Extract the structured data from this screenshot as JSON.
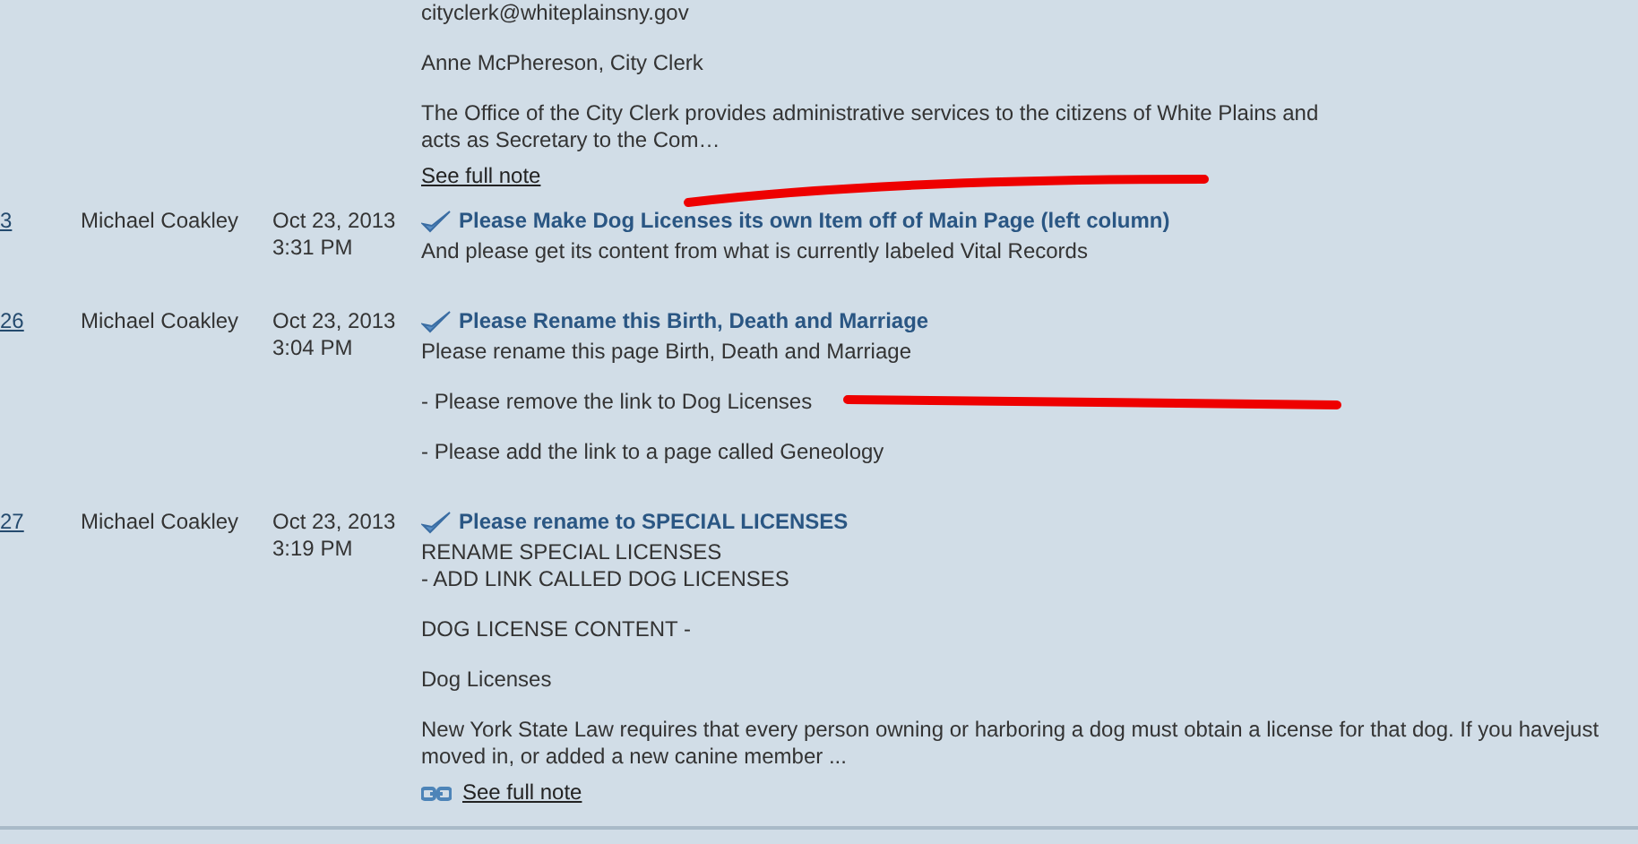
{
  "notes": [
    {
      "paragraphs": [
        {
          "lines": [
            "cityclerk@whiteplainsny.gov"
          ]
        },
        {
          "lines": [
            "Anne McPhereson, City Clerk"
          ]
        },
        {
          "lines": [
            "The Office of the City Clerk provides administrative services to the citizens of White Plains and",
            "acts as Secretary to the Com…"
          ]
        }
      ],
      "link": {
        "label": "See full note",
        "icon": false
      }
    },
    {
      "id": "3",
      "author": "Michael Coakley",
      "date": "Oct 23, 2013",
      "time": "3:31 PM",
      "title": "Please Make Dog Licenses its own Item off of Main Page (left column)",
      "paragraphs": [
        {
          "lines": [
            "And please get its content from what is currently labeled Vital Records"
          ]
        }
      ]
    },
    {
      "id": "26",
      "author": "Michael Coakley",
      "date": "Oct 23, 2013",
      "time": "3:04 PM",
      "title": "Please Rename this Birth, Death and Marriage",
      "paragraphs": [
        {
          "lines": [
            "Please rename this page Birth, Death and Marriage"
          ]
        },
        {
          "lines": [
            "- Please remove the link to Dog Licenses"
          ]
        },
        {
          "lines": [
            "- Please add the link to a page called Geneology"
          ]
        }
      ]
    },
    {
      "id": "27",
      "author": "Michael Coakley",
      "date": "Oct 23, 2013",
      "time": "3:19 PM",
      "title": "Please rename to SPECIAL LICENSES",
      "paragraphs": [
        {
          "lines": [
            "RENAME SPECIAL LICENSES",
            "- ADD LINK CALLED DOG LICENSES"
          ]
        },
        {
          "lines": [
            "DOG LICENSE CONTENT -"
          ]
        },
        {
          "lines": [
            "Dog Licenses"
          ]
        },
        {
          "lines": [
            "New York State Law requires that every person owning or harboring a dog must obtain a license for that dog. If you havejust",
            "moved in, or added a new canine member ..."
          ]
        }
      ],
      "link": {
        "label": "See full note",
        "icon": true
      }
    }
  ]
}
